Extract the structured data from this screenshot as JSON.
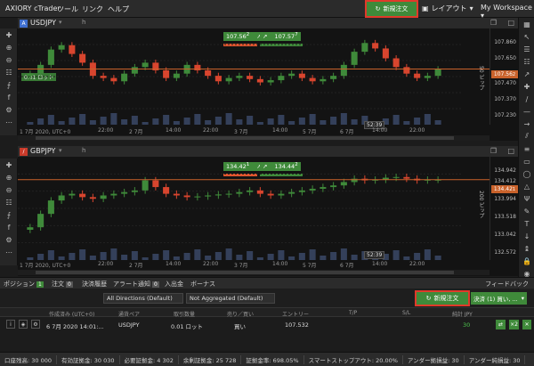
{
  "app": {
    "title": "AXIORY cTrader",
    "menu": [
      "ツール",
      "リンク",
      "ヘルプ"
    ],
    "new_order": "新規注文",
    "layout": "レイアウト",
    "workspace": "My Workspace"
  },
  "colors": {
    "accent_green": "#3f8a3a",
    "highlight_red": "#e03a2a",
    "bull": "#3f8a3a",
    "bear": "#d8452e",
    "price_line": "#c9622b"
  },
  "chart_top": {
    "symbol_badge": "A",
    "symbol": "USDJPY",
    "timeframe": "h",
    "bid": "107.56",
    "bid_sup": "2",
    "ask": "107.57",
    "ask_sup": "7",
    "position_label": "0.01 ロット",
    "y_ticks": [
      "107.860",
      "107.650",
      "107.470",
      "107.370",
      "107.230"
    ],
    "current_price": "107.56",
    "current_price_sup": "2",
    "x_ticks": [
      "1 7月 2020, UTC+0",
      "22:00",
      "2 7月",
      "14:00",
      "22:00",
      "3 7月",
      "14:00",
      "5 7月",
      "6 7月",
      "14:00",
      "22:00"
    ],
    "countdown": "52:39",
    "pip_label": "50 ピップ",
    "chart_data": {
      "type": "candlestick",
      "title": "USDJPY",
      "ylim": [
        107.2,
        107.9
      ],
      "approx_closes": [
        107.52,
        107.6,
        107.74,
        107.78,
        107.7,
        107.62,
        107.5,
        107.48,
        107.45,
        107.52,
        107.58,
        107.62,
        107.55,
        107.48,
        107.52,
        107.6,
        107.55,
        107.5,
        107.45,
        107.48,
        107.5,
        107.47,
        107.44,
        107.46,
        107.5,
        107.52,
        107.48,
        107.45,
        107.47,
        107.5,
        107.6,
        107.72,
        107.8,
        107.75,
        107.66,
        107.58,
        107.52,
        107.48,
        107.5,
        107.56
      ]
    }
  },
  "chart_bottom": {
    "symbol_badge": "∕",
    "symbol": "GBPJPY",
    "timeframe": "h",
    "bid": "134.42",
    "bid_sup": "1",
    "ask": "134.44",
    "ask_sup": "2",
    "y_ticks": [
      "134.942",
      "134.412",
      "133.994",
      "133.518",
      "133.042",
      "132.572"
    ],
    "current_price": "134.42",
    "current_price_sup": "1",
    "x_ticks": [
      "1 7月 2020, UTC+0",
      "22:00",
      "2 7月",
      "14:00",
      "22:00",
      "3 7月",
      "14:00",
      "5 7月",
      "6 7月",
      "14:00",
      "22:00"
    ],
    "countdown": "52:39",
    "pip_label": "200 ピップ",
    "chart_data": {
      "type": "candlestick",
      "title": "GBPJPY",
      "ylim": [
        132.5,
        135.0
      ],
      "approx_closes": [
        133.0,
        133.4,
        133.8,
        133.95,
        134.0,
        133.9,
        133.85,
        133.95,
        134.0,
        134.05,
        134.1,
        134.4,
        134.2,
        134.0,
        133.95,
        133.9,
        133.92,
        133.95,
        133.98,
        134.0,
        134.05,
        134.1,
        134.0,
        133.95,
        134.0,
        134.05,
        134.1,
        134.15,
        134.2,
        134.25,
        134.35,
        134.45,
        134.4,
        134.42,
        134.48,
        134.5,
        134.45,
        134.4,
        134.42,
        134.42
      ]
    }
  },
  "tabs": [
    {
      "label": "ポジション",
      "count": "1"
    },
    {
      "label": "注文",
      "count": "0"
    },
    {
      "label": "決済履歴",
      "count": ""
    },
    {
      "label": "アラート通知",
      "count": "0"
    },
    {
      "label": "入出金",
      "count": ""
    },
    {
      "label": "ボーナス",
      "count": ""
    }
  ],
  "feedback": "フィードバック",
  "filters": {
    "direction": "All Directions (Default)",
    "aggregation": "Not Aggregated (Default)"
  },
  "settle_button": "決済 (1) 買い, ...",
  "table": {
    "headers": [
      "作成済み (UTC+0)",
      "通貨ペア",
      "取引数量",
      "売り／買い",
      "エントリー",
      "T/P",
      "S/L",
      "純計 JPY"
    ],
    "row": {
      "created": "6 7月 2020 14:01:...",
      "symbol": "USDJPY",
      "volume": "0.01 ロット",
      "side": "買い",
      "entry": "107.532",
      "tp": "",
      "sl": "",
      "net": "30"
    }
  },
  "status": [
    "口座残高: 30 000",
    "有効証拠金: 30 030",
    "必要証拠金: 4 302",
    "余剰証拠金: 25 728",
    "証拠金率: 698.05%",
    "スマートストップアウト: 20.00%",
    "アンダー拠損益: 30",
    "アンダー純損益: 30"
  ]
}
